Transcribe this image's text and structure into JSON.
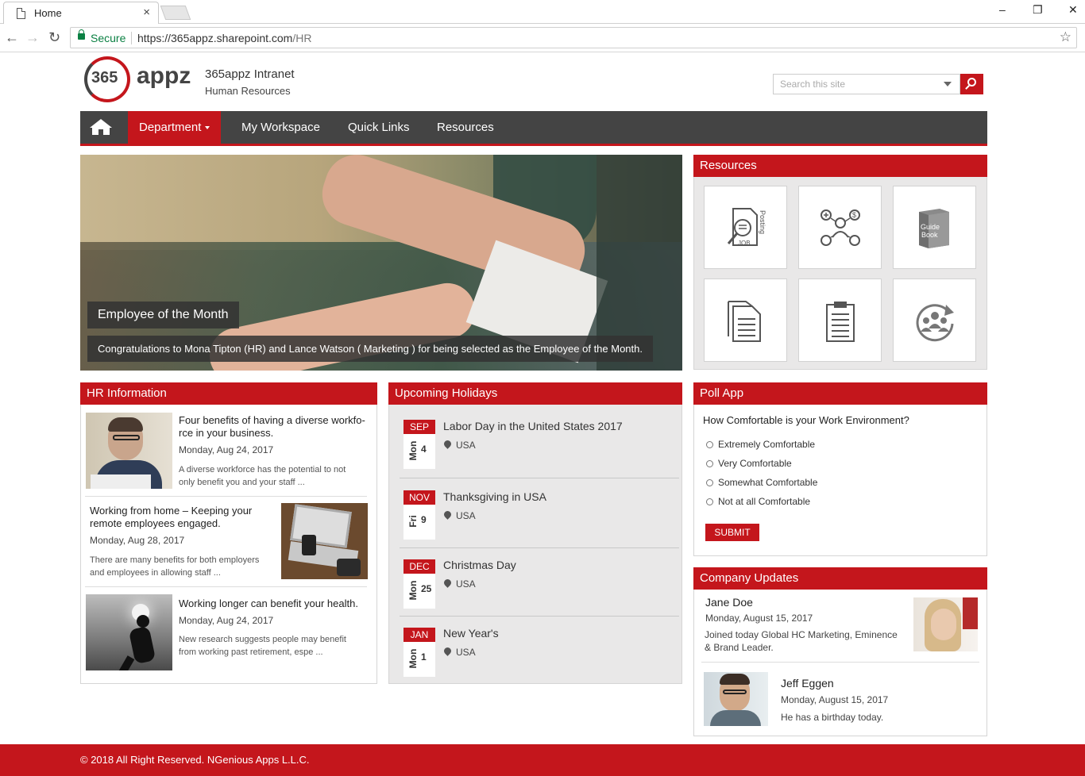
{
  "browser": {
    "tab_title": "Home",
    "tab_close": "×",
    "window_controls": [
      "–",
      "❐",
      "✕"
    ],
    "secure_label": "Secure",
    "url_host": "https://365appz.sharepoint.com",
    "url_path": "/HR"
  },
  "header": {
    "logo_number": "365",
    "logo_text": "appz",
    "site_title": "365appz Intranet",
    "site_subtitle": "Human Resources",
    "search_placeholder": "Search this site"
  },
  "nav": {
    "items": [
      {
        "label": "Department"
      },
      {
        "label": "My Workspace"
      },
      {
        "label": "Quick Links"
      },
      {
        "label": "Resources"
      }
    ]
  },
  "hero": {
    "title": "Employee of the Month",
    "caption": "Congratulations to Mona Tipton (HR) and Lance Watson ( Marketing ) for being selected as the Employee of the Month."
  },
  "resources": {
    "title": "Resources",
    "tiles": [
      {
        "icon": "job-posting-icon",
        "text": "Posting",
        "text2": "JOB"
      },
      {
        "icon": "benefits-icon"
      },
      {
        "icon": "guide-book-icon",
        "text": "Guide",
        "text2": "Book"
      },
      {
        "icon": "document-icon"
      },
      {
        "icon": "clipboard-icon"
      },
      {
        "icon": "team-refresh-icon"
      }
    ]
  },
  "hr": {
    "title": "HR Information",
    "items": [
      {
        "title_line1": "Four benefits of having a diverse workfo-",
        "title_line2": "rce in your business.",
        "date": "Monday, Aug 24, 2017",
        "desc_line1": "A diverse workforce has the potential to not",
        "desc_line2": "only benefit you and your staff ..."
      },
      {
        "title_line1": "Working from home – Keeping your",
        "title_line2": "remote employees engaged.",
        "date": "Monday, Aug 28, 2017",
        "desc_line1": "There are many benefits for both employers",
        "desc_line2": "and employees in allowing staff ..."
      },
      {
        "title_line1": "Working longer can benefit your health.",
        "title_line2": "",
        "date": "Monday, Aug 24, 2017",
        "desc_line1": "New research suggests people may benefit",
        "desc_line2": "from working past retirement, espe ..."
      }
    ]
  },
  "holidays": {
    "title": "Upcoming Holidays",
    "items": [
      {
        "month": "SEP",
        "weekday": "Mon",
        "day": "4",
        "name": "Labor Day in the United States 2017",
        "location": "USA"
      },
      {
        "month": "NOV",
        "weekday": "Fri",
        "day": "9",
        "name": "Thanksgiving in USA",
        "location": "USA"
      },
      {
        "month": "DEC",
        "weekday": "Mon",
        "day": "25",
        "name": "Christmas Day",
        "location": "USA"
      },
      {
        "month": "JAN",
        "weekday": "Mon",
        "day": "1",
        "name": "New Year's",
        "location": "USA"
      }
    ]
  },
  "poll": {
    "title": "Poll App",
    "question": "How Comfortable is your Work Environment?",
    "options": [
      "Extremely Comfortable",
      "Very Comfortable",
      "Somewhat Comfortable",
      "Not at all Comfortable"
    ],
    "submit": "SUBMIT"
  },
  "updates": {
    "title": "Company Updates",
    "items": [
      {
        "name": "Jane Doe",
        "date": "Monday, August 15, 2017",
        "desc_line1": "Joined today Global HC Marketing, Eminence",
        "desc_line2": "& Brand Leader."
      },
      {
        "name": "Jeff Eggen",
        "date": "Monday, August 15, 2017",
        "desc_line1": "He has a birthday today.",
        "desc_line2": ""
      }
    ]
  },
  "footer": {
    "text": "© 2018 All Right Reserved. NGenious Apps L.L.C."
  },
  "colors": {
    "brand_red": "#c4161c",
    "nav_dark": "#444444",
    "panel_gray": "#e9e8e8"
  }
}
